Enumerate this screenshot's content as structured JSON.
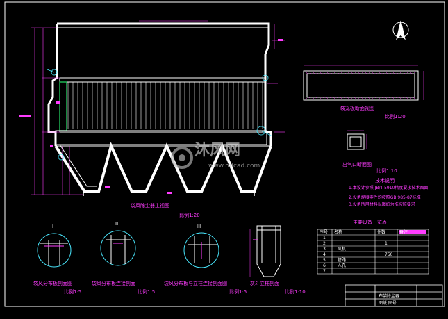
{
  "drawing": {
    "main_view": {
      "title": "袋风除尘器主视图",
      "scale": "比例1:20"
    },
    "top_right_view": {
      "title": "袋笼板断面视图",
      "scale": "比例1:20"
    },
    "small_view": {
      "title": "出气口断面图",
      "scale": "比例1:10"
    },
    "details": [
      {
        "roman": "I",
        "title": "袋风分布板剖面图",
        "scale": "比例1:5"
      },
      {
        "roman": "II",
        "title": "袋风分布板连接剖面",
        "scale": "比例1:5"
      },
      {
        "roman": "III",
        "title": "袋风分布板与立柱连接剖面图",
        "scale": "比例1:5"
      },
      {
        "roman": "",
        "title": "灰斗立柱剖面",
        "scale": "比例1:10"
      }
    ],
    "notes": {
      "title": "技术说明",
      "items": [
        "1.本设计参照 JB/T 5910精度要求技术图面",
        "2.设备焊接零件均按照GB 985-87标准",
        "3.设备所用材料以图纸为准按照要求"
      ]
    },
    "parts_table": {
      "title": "主要设备一览表",
      "headers": [
        "序号",
        "名称",
        "件数",
        "备注"
      ],
      "rows": [
        {
          "no": "1",
          "name": "",
          "qty": "",
          "note": ""
        },
        {
          "no": "2",
          "name": "",
          "qty": "1",
          "note": ""
        },
        {
          "no": "3",
          "name": "风机",
          "qty": "",
          "note": ""
        },
        {
          "no": "4",
          "name": "",
          "qty": "750",
          "note": ""
        },
        {
          "no": "5",
          "name": "管路",
          "qty": "",
          "note": ""
        },
        {
          "no": "6",
          "name": "人孔",
          "qty": "",
          "note": ""
        },
        {
          "no": "7",
          "name": "",
          "qty": "",
          "note": ""
        }
      ]
    },
    "title_block": {
      "line1": "布袋除尘器",
      "line2": "图纸 图号"
    },
    "watermark": {
      "brand": "沐风网",
      "url": "www.mfcad.com"
    },
    "colors": {
      "background": "#000000",
      "line": "#ffffff",
      "dim": "#ff3cff",
      "annotation": "#49e8ff",
      "accent_green": "#21c25a"
    }
  }
}
